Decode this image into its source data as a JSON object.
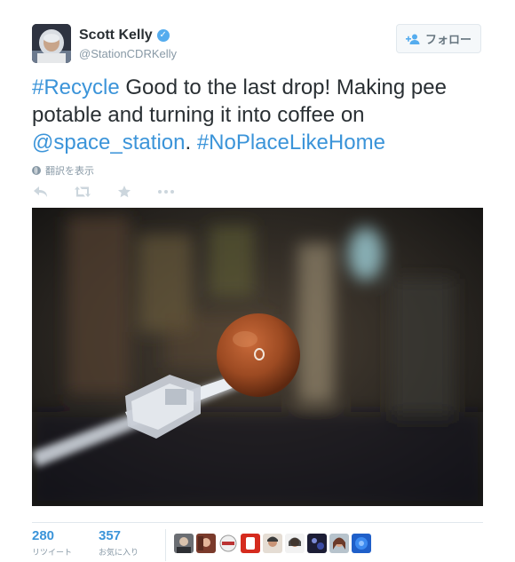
{
  "user": {
    "display_name": "Scott Kelly",
    "handle": "@StationCDRKelly",
    "verified_icon": "verified-badge-icon"
  },
  "follow_button": {
    "label": "フォロー",
    "icon": "add-user-icon"
  },
  "tweet": {
    "segments": [
      {
        "text": "#Recycle",
        "type": "hashtag"
      },
      {
        "text": " Good to the last drop! Making pee potable and turning it into coffee on ",
        "type": "text"
      },
      {
        "text": "@space_station",
        "type": "mention"
      },
      {
        "text": ". ",
        "type": "text"
      },
      {
        "text": "#NoPlaceLikeHome",
        "type": "hashtag"
      }
    ],
    "translate_label": "翻訳を表示"
  },
  "actions": [
    {
      "name": "reply",
      "icon": "reply-icon"
    },
    {
      "name": "retweet",
      "icon": "retweet-icon"
    },
    {
      "name": "favorite",
      "icon": "star-icon"
    },
    {
      "name": "more",
      "icon": "more-dots-icon"
    }
  ],
  "stats": {
    "retweets": {
      "count": "280",
      "label": "リツイート"
    },
    "favorites": {
      "count": "357",
      "label": "お気に入り"
    }
  },
  "colors": {
    "link": "#3b94d9",
    "text": "#292f33",
    "muted": "#8899a6",
    "icon": "#ccd6dd"
  }
}
